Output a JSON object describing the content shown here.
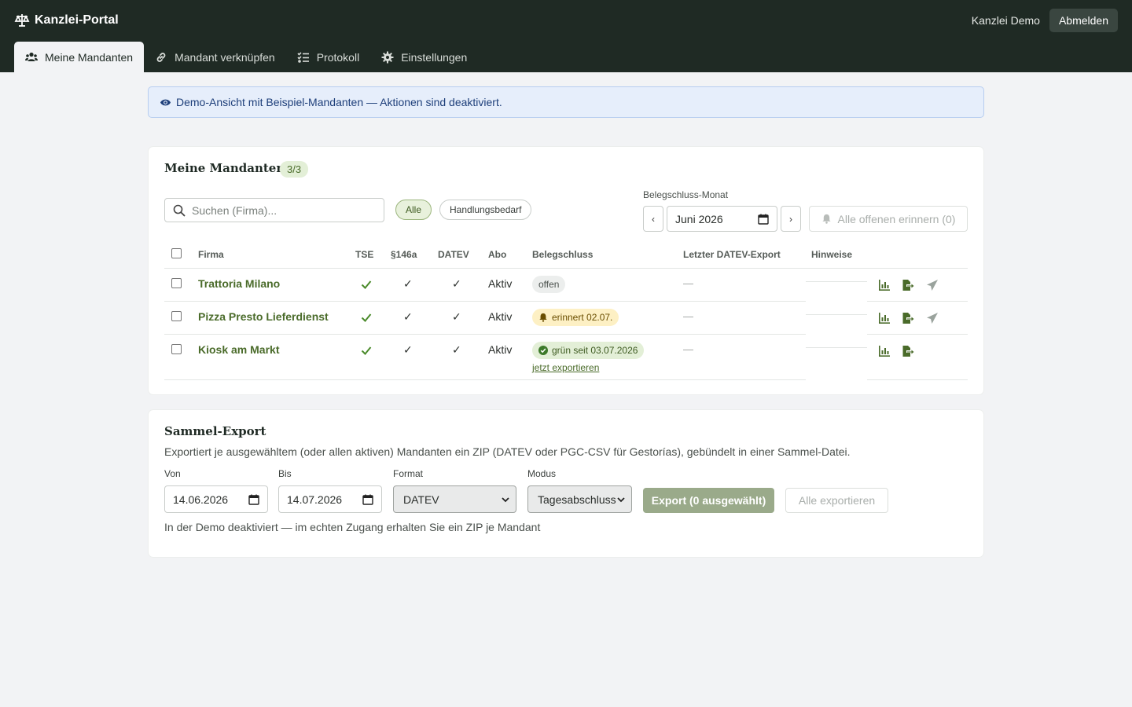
{
  "app": {
    "title": "Kanzlei-Portal",
    "user": "Kanzlei Demo",
    "logout_label": "Abmelden"
  },
  "tabs": [
    {
      "label": "Meine Mandanten",
      "icon": "users-icon",
      "active": true
    },
    {
      "label": "Mandant verknüpfen",
      "icon": "link-icon",
      "active": false
    },
    {
      "label": "Protokoll",
      "icon": "list-check-icon",
      "active": false
    },
    {
      "label": "Einstellungen",
      "icon": "gear-icon",
      "active": false
    }
  ],
  "banner": {
    "text": "Demo-Ansicht mit Beispiel-Mandanten — Aktionen sind deaktiviert."
  },
  "clients": {
    "title": "Meine Mandanten",
    "count": "3/3",
    "search_placeholder": "Suchen (Firma)...",
    "filters": [
      {
        "label": "Alle",
        "active": true
      },
      {
        "label": "Handlungsbedarf",
        "active": false
      }
    ],
    "month_label": "Belegschluss-Monat",
    "month_value": "Juni 2026",
    "prev_label": "‹",
    "next_label": "›",
    "remind_all_label": "Alle offenen erinnern (0)",
    "columns": [
      "Firma",
      "TSE",
      "§146a",
      "DATEV",
      "Abo",
      "Belegschluss",
      "Letzter DATEV-Export",
      "Hinweise"
    ],
    "rows": [
      {
        "firm": "Trattoria Milano",
        "tse": "✓",
        "s146a": "✓",
        "datev": "✓",
        "abo": "Aktiv",
        "status": "offen",
        "status_type": "open",
        "status_link": "",
        "last_export": "—",
        "hint": "",
        "has_send": true
      },
      {
        "firm": "Pizza Presto Lieferdienst",
        "tse": "✓",
        "s146a": "✓",
        "datev": "✓",
        "abo": "Aktiv",
        "status": "erinnert 02.07.",
        "status_type": "warn",
        "status_link": "",
        "last_export": "—",
        "hint": "",
        "has_send": true
      },
      {
        "firm": "Kiosk am Markt",
        "tse": "✓",
        "s146a": "✓",
        "datev": "✓",
        "abo": "Aktiv",
        "status": "grün seit 03.07.2026",
        "status_type": "ok",
        "status_link": "jetzt exportieren",
        "last_export": "—",
        "hint": "",
        "has_send": false
      }
    ],
    "colors": {
      "accent": "#4a6b2a",
      "dark": "#1f2a24"
    }
  },
  "export": {
    "title": "Sammel-Export",
    "description": "Exportiert je ausgewähltem (oder allen aktiven) Mandanten ein ZIP (DATEV oder PGC-CSV für Gestorías), gebündelt in einer Sammel-Datei.",
    "from_label": "Von",
    "from_value": "14.06.2026",
    "to_label": "Bis",
    "to_value": "14.07.2026",
    "format_label": "Format",
    "format_value": "DATEV",
    "mode_label": "Modus",
    "mode_value": "Tagesabschluss",
    "export_label": "Export (0 ausgewählt)",
    "export_all_label": "Alle exportieren",
    "note": "In der Demo deaktiviert — im echten Zugang erhalten Sie ein ZIP je Mandant"
  }
}
